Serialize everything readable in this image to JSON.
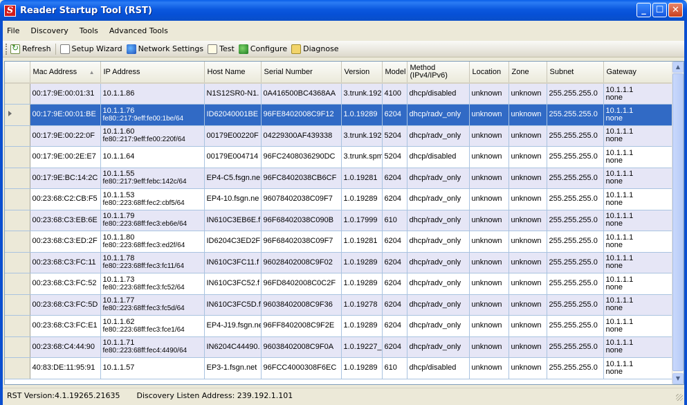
{
  "window": {
    "title": "Reader Startup Tool (RST)",
    "app_icon_letter": "S",
    "buttons": {
      "minimize": "_",
      "maximize": "☐",
      "close": "✕"
    }
  },
  "menu": [
    "File",
    "Discovery",
    "Tools",
    "Advanced Tools"
  ],
  "toolbar": {
    "refresh": "Refresh",
    "setup_wizard": "Setup Wizard",
    "network_settings": "Network Settings",
    "test": "Test",
    "configure": "Configure",
    "diagnose": "Diagnose"
  },
  "grid": {
    "columns": [
      "Mac Address",
      "IP Address",
      "Host Name",
      "Serial Number",
      "Version",
      "Model",
      "Method (IPv4/IPv6)",
      "Location",
      "Zone",
      "Subnet",
      "Gateway"
    ],
    "sort_column": "Mac Address",
    "selected_row": 1,
    "rows": [
      {
        "mac": "00:17:9E:00:01:31",
        "ip": "10.1.1.86",
        "ip6": "",
        "host": "N1S12SR0-N1.",
        "serial": "0A416500BC4368AA",
        "version": "3.trunk.192",
        "model": "4100",
        "method": "dhcp/disabled",
        "location": "unknown",
        "zone": "unknown",
        "subnet": "255.255.255.0",
        "gateway": "10.1.1.1",
        "gateway2": "none"
      },
      {
        "mac": "00:17:9E:00:01:BE",
        "ip": "10.1.1.76",
        "ip6": "fe80::217:9eff:fe00:1be/64",
        "host": "ID62040001BE",
        "serial": "96FE8402008C9F12",
        "version": "1.0.19289",
        "model": "6204",
        "method": "dhcp/radv_only",
        "location": "unknown",
        "zone": "unknown",
        "subnet": "255.255.255.0",
        "gateway": "10.1.1.1",
        "gateway2": "none"
      },
      {
        "mac": "00:17:9E:00:22:0F",
        "ip": "10.1.1.60",
        "ip6": "fe80::217:9eff:fe00:220f/64",
        "host": "00179E00220F",
        "serial": "04229300AF439338",
        "version": "3.trunk.192",
        "model": "5204",
        "method": "dhcp/radv_only",
        "location": "unknown",
        "zone": "unknown",
        "subnet": "255.255.255.0",
        "gateway": "10.1.1.1",
        "gateway2": "none"
      },
      {
        "mac": "00:17:9E:00:2E:E7",
        "ip": "10.1.1.64",
        "ip6": "",
        "host": "00179E004714",
        "serial": "96FC2408036290DC",
        "version": "3.trunk.spm",
        "model": "5204",
        "method": "dhcp/disabled",
        "location": "unknown",
        "zone": "unknown",
        "subnet": "255.255.255.0",
        "gateway": "10.1.1.1",
        "gateway2": "none"
      },
      {
        "mac": "00:17:9E:BC:14:2C",
        "ip": "10.1.1.55",
        "ip6": "fe80::217:9eff:febc:142c/64",
        "host": "EP4-C5.fsgn.ne",
        "serial": "96FC8402038CB6CF",
        "version": "1.0.19281",
        "model": "6204",
        "method": "dhcp/radv_only",
        "location": "unknown",
        "zone": "unknown",
        "subnet": "255.255.255.0",
        "gateway": "10.1.1.1",
        "gateway2": "none"
      },
      {
        "mac": "00:23:68:C2:CB:F5",
        "ip": "10.1.1.53",
        "ip6": "fe80::223:68ff:fec2:cbf5/64",
        "host": "EP4-10.fsgn.ne",
        "serial": "96078402038C09F7",
        "version": "1.0.19289",
        "model": "6204",
        "method": "dhcp/radv_only",
        "location": "unknown",
        "zone": "unknown",
        "subnet": "255.255.255.0",
        "gateway": "10.1.1.1",
        "gateway2": "none"
      },
      {
        "mac": "00:23:68:C3:EB:6E",
        "ip": "10.1.1.79",
        "ip6": "fe80::223:68ff:fec3:eb6e/64",
        "host": "IN610C3EB6E.f",
        "serial": "96F68402038C090B",
        "version": "1.0.17999",
        "model": "610",
        "method": "dhcp/radv_only",
        "location": "unknown",
        "zone": "unknown",
        "subnet": "255.255.255.0",
        "gateway": "10.1.1.1",
        "gateway2": "none"
      },
      {
        "mac": "00:23:68:C3:ED:2F",
        "ip": "10.1.1.80",
        "ip6": "fe80::223:68ff:fec3:ed2f/64",
        "host": "ID6204C3ED2F",
        "serial": "96F68402038C09F7",
        "version": "1.0.19281",
        "model": "6204",
        "method": "dhcp/radv_only",
        "location": "unknown",
        "zone": "unknown",
        "subnet": "255.255.255.0",
        "gateway": "10.1.1.1",
        "gateway2": "none"
      },
      {
        "mac": "00:23:68:C3:FC:11",
        "ip": "10.1.1.78",
        "ip6": "fe80::223:68ff:fec3:fc11/64",
        "host": "IN610C3FC11.f",
        "serial": "96028402008C9F02",
        "version": "1.0.19289",
        "model": "6204",
        "method": "dhcp/radv_only",
        "location": "unknown",
        "zone": "unknown",
        "subnet": "255.255.255.0",
        "gateway": "10.1.1.1",
        "gateway2": "none"
      },
      {
        "mac": "00:23:68:C3:FC:52",
        "ip": "10.1.1.73",
        "ip6": "fe80::223:68ff:fec3:fc52/64",
        "host": "IN610C3FC52.f",
        "serial": "96FD8402008C0C2F",
        "version": "1.0.19289",
        "model": "6204",
        "method": "dhcp/radv_only",
        "location": "unknown",
        "zone": "unknown",
        "subnet": "255.255.255.0",
        "gateway": "10.1.1.1",
        "gateway2": "none"
      },
      {
        "mac": "00:23:68:C3:FC:5D",
        "ip": "10.1.1.77",
        "ip6": "fe80::223:68ff:fec3:fc5d/64",
        "host": "IN610C3FC5D.f",
        "serial": "96038402008C9F36",
        "version": "1.0.19278",
        "model": "6204",
        "method": "dhcp/radv_only",
        "location": "unknown",
        "zone": "unknown",
        "subnet": "255.255.255.0",
        "gateway": "10.1.1.1",
        "gateway2": "none"
      },
      {
        "mac": "00:23:68:C3:FC:E1",
        "ip": "10.1.1.62",
        "ip6": "fe80::223:68ff:fec3:fce1/64",
        "host": "EP4-J19.fsgn.ne",
        "serial": "96FF8402008C9F2E",
        "version": "1.0.19289",
        "model": "6204",
        "method": "dhcp/radv_only",
        "location": "unknown",
        "zone": "unknown",
        "subnet": "255.255.255.0",
        "gateway": "10.1.1.1",
        "gateway2": "none"
      },
      {
        "mac": "00:23:68:C4:44:90",
        "ip": "10.1.1.71",
        "ip6": "fe80::223:68ff:fec4:4490/64",
        "host": "IN6204C44490.",
        "serial": "96038402008C9F0A",
        "version": "1.0.19227_",
        "model": "6204",
        "method": "dhcp/radv_only",
        "location": "unknown",
        "zone": "unknown",
        "subnet": "255.255.255.0",
        "gateway": "10.1.1.1",
        "gateway2": "none"
      },
      {
        "mac": "40:83:DE:11:95:91",
        "ip": "10.1.1.57",
        "ip6": "",
        "host": "EP3-1.fsgn.net",
        "serial": "96FCC4000308F6EC",
        "version": "1.0.19289",
        "model": "610",
        "method": "dhcp/disabled",
        "location": "unknown",
        "zone": "unknown",
        "subnet": "255.255.255.0",
        "gateway": "10.1.1.1",
        "gateway2": "none"
      }
    ]
  },
  "status": {
    "version": "RST Version:4.1.19265.21635",
    "discovery": "Discovery Listen Address: 239.192.1.101"
  },
  "colors": {
    "titlebar": "#0b58df",
    "selected_row": "#316ac5",
    "alt_row": "#e6e6f6",
    "chrome": "#ece9d8"
  }
}
